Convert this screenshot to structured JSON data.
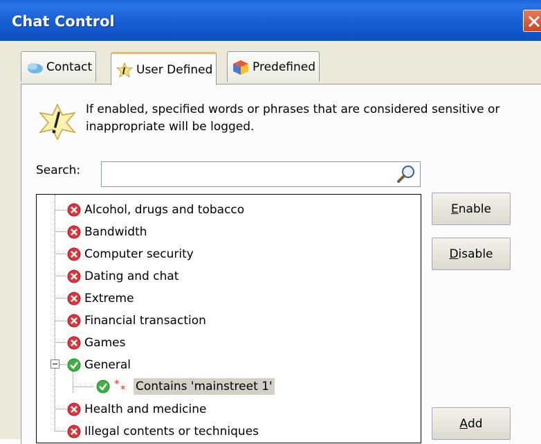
{
  "window": {
    "title": "Chat Control"
  },
  "tabs": [
    {
      "label": "Contact",
      "icon": "contact-icon",
      "active": false
    },
    {
      "label": "User Defined",
      "icon": "user-defined-icon",
      "active": true
    },
    {
      "label": "Predefined",
      "icon": "predefined-icon",
      "active": false
    }
  ],
  "info": {
    "text": "If enabled, specified words or phrases that are considered sensitive or inappropriate will be logged."
  },
  "search": {
    "label": "Search:",
    "value": ""
  },
  "tree": {
    "items": [
      {
        "label": "Alcohol, drugs and tobacco",
        "status": "disabled"
      },
      {
        "label": "Bandwidth",
        "status": "disabled"
      },
      {
        "label": "Computer security",
        "status": "disabled"
      },
      {
        "label": "Dating and chat",
        "status": "disabled"
      },
      {
        "label": "Extreme",
        "status": "disabled"
      },
      {
        "label": "Financial transaction",
        "status": "disabled"
      },
      {
        "label": "Games",
        "status": "disabled"
      },
      {
        "label": "General",
        "status": "enabled",
        "expanded": true
      },
      {
        "label": "Contains 'mainstreet 1'",
        "status": "enabled",
        "child": true,
        "selected": true
      },
      {
        "label": "Health and medicine",
        "status": "disabled"
      },
      {
        "label": "Illegal contents or techniques",
        "status": "disabled"
      }
    ]
  },
  "buttons": {
    "enable": {
      "mnemonic": "E",
      "rest": "nable"
    },
    "disable": {
      "mnemonic": "D",
      "rest": "isable"
    },
    "add": {
      "mnemonic": "A",
      "rest": "dd"
    }
  },
  "colors": {
    "titlebar": "#175dd2",
    "dialog": "#ece9d8",
    "tab_highlight": "#f3b94c",
    "disabled_icon": "#d9363e",
    "enabled_icon": "#3fb043"
  }
}
